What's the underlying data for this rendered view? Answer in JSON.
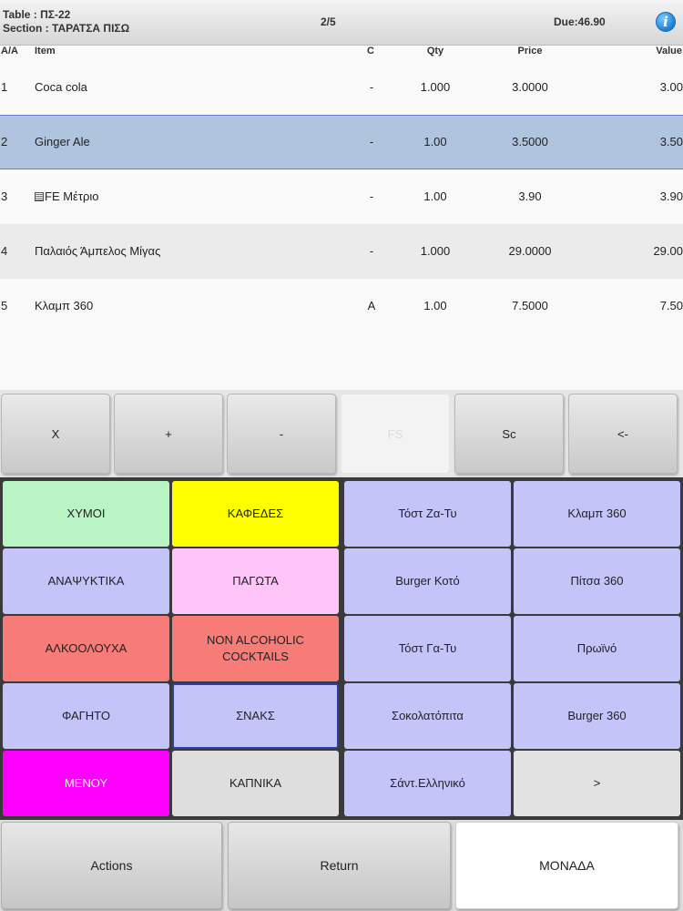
{
  "header": {
    "table": "Table : ΠΣ-22",
    "section": "Section : ΤΑΡΑΤΣΑ ΠΙΣΩ",
    "page": "2/5",
    "due": "Due:46.90",
    "info_icon": "info-icon"
  },
  "order": {
    "columns": {
      "aa": "A/A",
      "item": "Item",
      "c": "C",
      "qty": "Qty",
      "price": "Price",
      "value": "Value"
    },
    "rows": [
      {
        "aa": "1",
        "item": "Coca cola",
        "c": "-",
        "qty": "1.000",
        "price": "3.0000",
        "value": "3.00"
      },
      {
        "aa": "2",
        "item": "Ginger Ale",
        "c": "-",
        "qty": "1.00",
        "price": "3.5000",
        "value": "3.50"
      },
      {
        "aa": "3",
        "item": "FE Μέτριο",
        "c": "-",
        "qty": "1.00",
        "price": "3.90",
        "value": "3.90"
      },
      {
        "aa": "4",
        "item": "Παλαιός Άμπελος Μίγας",
        "c": "-",
        "qty": "1.000",
        "price": "29.0000",
        "value": "29.00"
      },
      {
        "aa": "5",
        "item": "Κλαμπ 360",
        "c": "A",
        "qty": "1.00",
        "price": "7.5000",
        "value": "7.50"
      }
    ]
  },
  "fkeys": [
    "X",
    "+",
    "-",
    "FS",
    "Sc",
    "<-"
  ],
  "categories": [
    {
      "label": "ΧΥΜΟΙ",
      "bg": "#b9f4c4",
      "fg": "#222222"
    },
    {
      "label": "ΚΑΦΕΔΕΣ",
      "bg": "#ffff00",
      "fg": "#222222"
    },
    {
      "label": "ΑΝΑΨΥΚΤΙΚΑ",
      "bg": "#c4c4f8",
      "fg": "#222222"
    },
    {
      "label": "ΠΑΓΩΤΑ",
      "bg": "#ffc4f8",
      "fg": "#222222"
    },
    {
      "label": "ΑΛΚΟΟΛΟΥΧΑ",
      "bg": "#f77b76",
      "fg": "#222222"
    },
    {
      "label": "NON ALCOHOLIC COCKTAILS",
      "bg": "#f77b76",
      "fg": "#222222"
    },
    {
      "label": "ΦΑΓΗΤΟ",
      "bg": "#c4c4f8",
      "fg": "#222222"
    },
    {
      "label": "ΣΝΑΚΣ",
      "bg": "#c4c4f8",
      "fg": "#222222"
    },
    {
      "label": "ΜΕΝΟΥ",
      "bg": "#ff00ff",
      "fg": "#ffffff"
    },
    {
      "label": "ΚΑΠΝΙΚΑ",
      "bg": "#dedede",
      "fg": "#222222"
    }
  ],
  "products": [
    {
      "label": "Τόστ Ζα-Τυ",
      "bg": "#c4c4f8"
    },
    {
      "label": "Κλαμπ 360",
      "bg": "#c4c4f8"
    },
    {
      "label": "Burger Κοτό",
      "bg": "#c4c4f8"
    },
    {
      "label": "Πίτσα 360",
      "bg": "#c4c4f8"
    },
    {
      "label": "Τόστ Γα-Τυ",
      "bg": "#c4c4f8"
    },
    {
      "label": "Πρωϊνό",
      "bg": "#c4c4f8"
    },
    {
      "label": "Σοκολατόπιτα",
      "bg": "#c4c4f8"
    },
    {
      "label": "Burger 360",
      "bg": "#c4c4f8"
    },
    {
      "label": "Σάντ.Ελληνικό",
      "bg": "#c4c4f8"
    },
    {
      "label": ">",
      "bg": "#e2e2e2"
    }
  ],
  "bottom": {
    "actions": "Actions",
    "return": "Return",
    "unit": "ΜΟΝΑΔΑ"
  }
}
